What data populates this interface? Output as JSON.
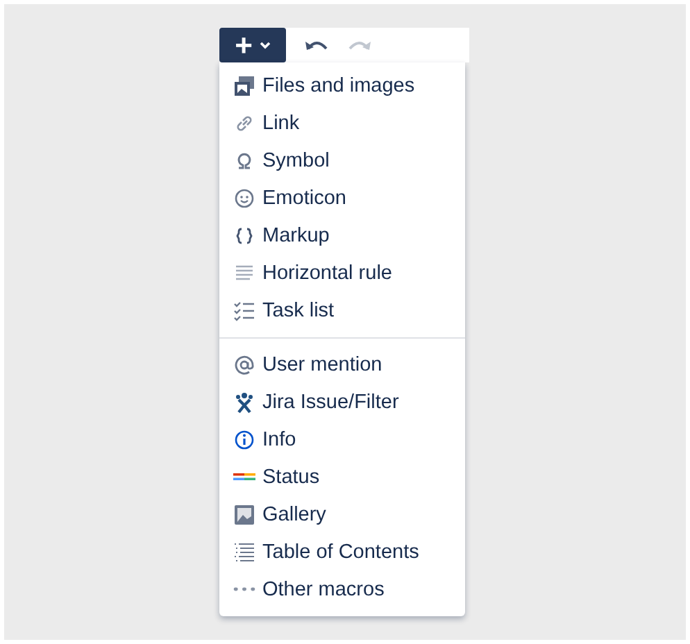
{
  "toolbar": {
    "insert_button": {
      "label": "+",
      "expanded": true
    },
    "undo": {
      "disabled": false
    },
    "redo": {
      "disabled": true
    }
  },
  "menu": {
    "sections": [
      {
        "items": [
          {
            "label": "Files and images"
          },
          {
            "label": "Link"
          },
          {
            "label": "Symbol"
          },
          {
            "label": "Emoticon"
          },
          {
            "label": "Markup"
          },
          {
            "label": "Horizontal rule"
          },
          {
            "label": "Task list"
          }
        ]
      },
      {
        "items": [
          {
            "label": "User mention"
          },
          {
            "label": "Jira Issue/Filter"
          },
          {
            "label": "Info"
          },
          {
            "label": "Status"
          },
          {
            "label": "Gallery"
          },
          {
            "label": "Table of Contents"
          },
          {
            "label": "Other macros"
          }
        ]
      }
    ]
  }
}
